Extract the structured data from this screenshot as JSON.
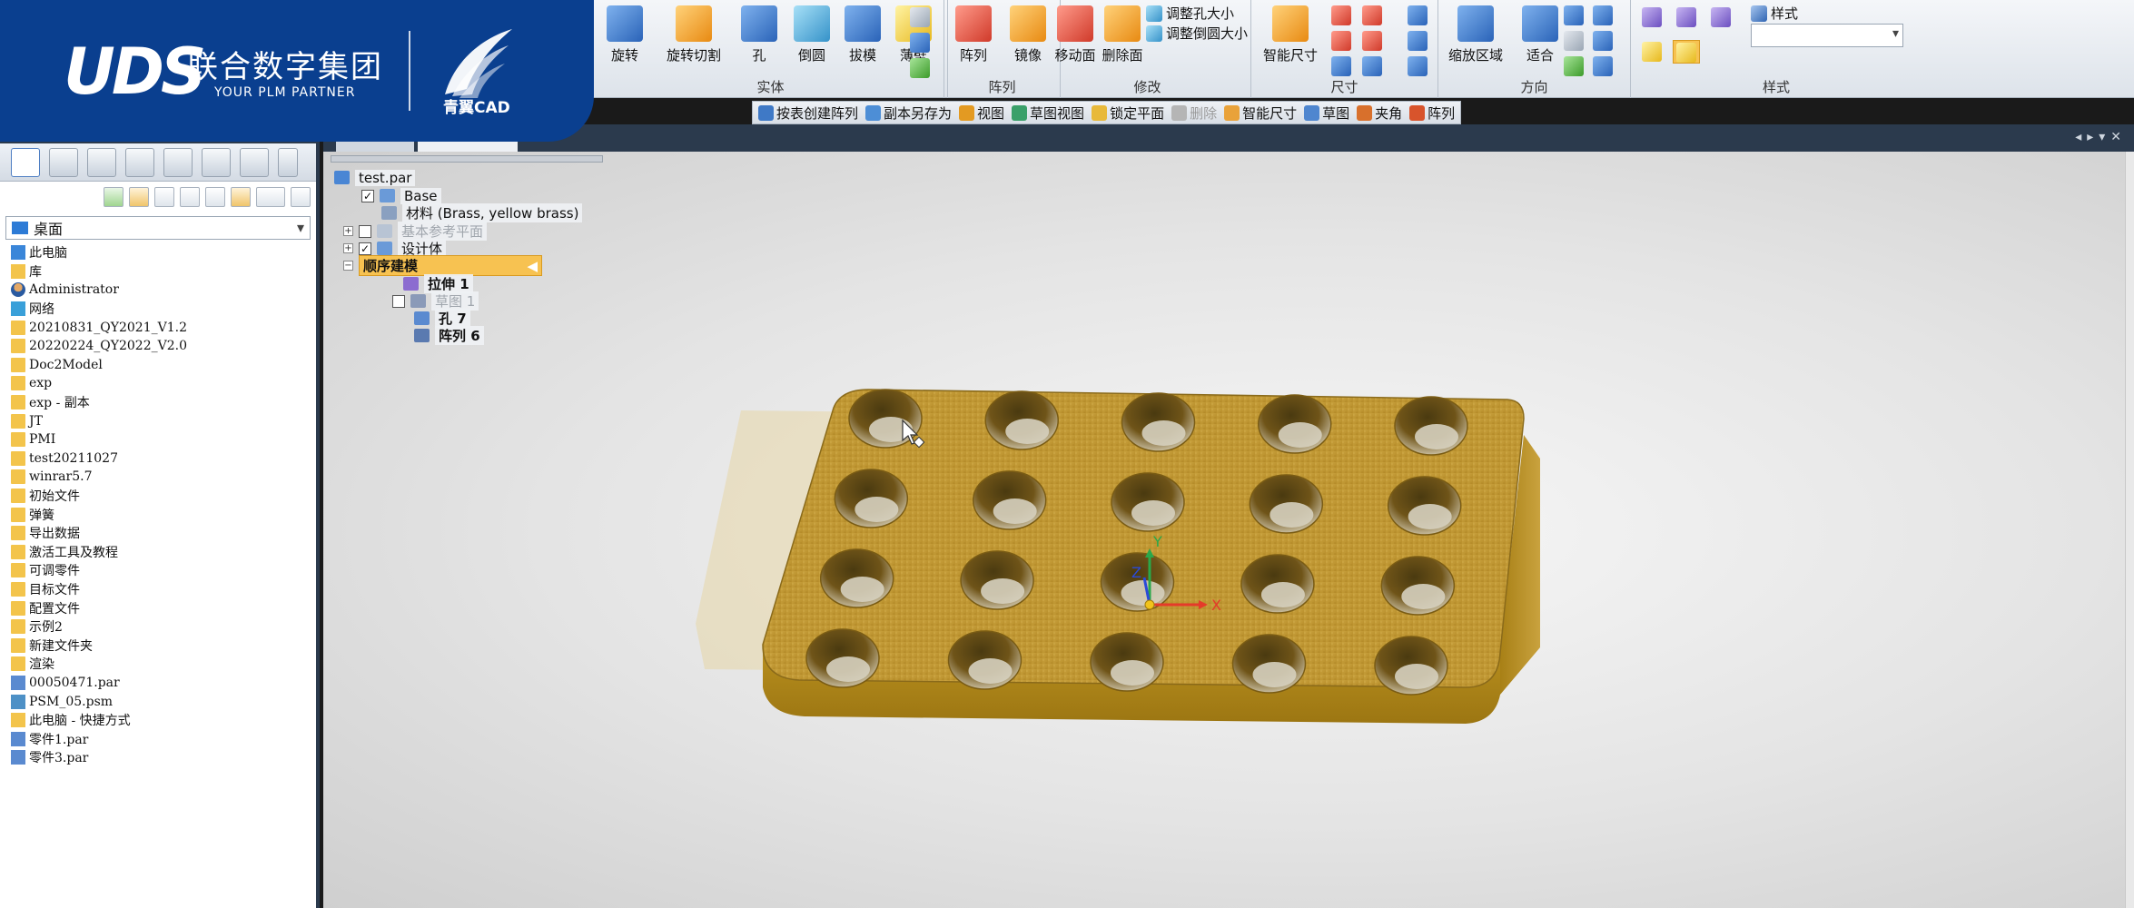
{
  "ribbon": {
    "groups": [
      {
        "title": "实体",
        "buttons": [
          "旋转",
          "旋转切割",
          "孔",
          "倒圆",
          "拔模",
          "薄壁"
        ]
      },
      {
        "title": "阵列",
        "buttons": [
          "阵列",
          "镜像"
        ]
      },
      {
        "title": "修改",
        "buttons": [
          "移动面",
          "删除面"
        ],
        "small": [
          "调整孔大小",
          "调整倒圆大小"
        ]
      },
      {
        "title": "尺寸",
        "buttons": [
          "智能尺寸"
        ]
      },
      {
        "title": "方向",
        "buttons": [
          "缩放区域",
          "适合"
        ]
      },
      {
        "title": "样式",
        "small": [
          "样式"
        ]
      }
    ]
  },
  "logo": {
    "brand": "UDS",
    "company": "联合数字集团",
    "tagline": "YOUR PLM PARTNER",
    "product": "青翼CAD"
  },
  "subtoolbar": {
    "items": [
      "按表创建阵列",
      "副本另存为",
      "视图",
      "草图视图",
      "锁定平面",
      "删除",
      "智能尺寸",
      "草图",
      "夹角",
      "阵列"
    ]
  },
  "leftpanel": {
    "path": "桌面",
    "items": [
      {
        "label": "此电脑",
        "icon": "pc"
      },
      {
        "label": "库",
        "icon": "lib"
      },
      {
        "label": "Administrator",
        "icon": "user"
      },
      {
        "label": "网络",
        "icon": "net"
      },
      {
        "label": "20210831_QY2021_V1.2",
        "icon": "folder"
      },
      {
        "label": "20220224_QY2022_V2.0",
        "icon": "folder"
      },
      {
        "label": "Doc2Model",
        "icon": "folder"
      },
      {
        "label": "exp",
        "icon": "folder"
      },
      {
        "label": "exp - 副本",
        "icon": "folder"
      },
      {
        "label": "JT",
        "icon": "folder"
      },
      {
        "label": "PMI",
        "icon": "folder"
      },
      {
        "label": "test20211027",
        "icon": "folder"
      },
      {
        "label": "winrar5.7",
        "icon": "folder"
      },
      {
        "label": "初始文件",
        "icon": "folder"
      },
      {
        "label": "弹簧",
        "icon": "folder"
      },
      {
        "label": "导出数据",
        "icon": "folder"
      },
      {
        "label": "激活工具及教程",
        "icon": "folder"
      },
      {
        "label": "可调零件",
        "icon": "folder"
      },
      {
        "label": "目标文件",
        "icon": "folder"
      },
      {
        "label": "配置文件",
        "icon": "folder"
      },
      {
        "label": "示例2",
        "icon": "folder"
      },
      {
        "label": "新建文件夹",
        "icon": "folder"
      },
      {
        "label": "渲染",
        "icon": "folder"
      },
      {
        "label": "00050471.par",
        "icon": "par"
      },
      {
        "label": "PSM_05.psm",
        "icon": "psm"
      },
      {
        "label": "此电脑 - 快捷方式",
        "icon": "link"
      },
      {
        "label": "零件1.par",
        "icon": "par"
      },
      {
        "label": "零件3.par",
        "icon": "par"
      }
    ]
  },
  "tree": {
    "root": "test.par",
    "base": "Base",
    "material": "材料 (Brass, yellow brass)",
    "ref_planes": "基本参考平面",
    "design_body": "设计体",
    "sequential": "顺序建模",
    "features": [
      "拉伸 1",
      "草图 1",
      "孔 7",
      "阵列 6"
    ]
  },
  "triad": {
    "x": "X",
    "y": "Y",
    "z": "Z"
  },
  "model": {
    "rows": 4,
    "cols": 5,
    "color": "#c9a23a"
  }
}
